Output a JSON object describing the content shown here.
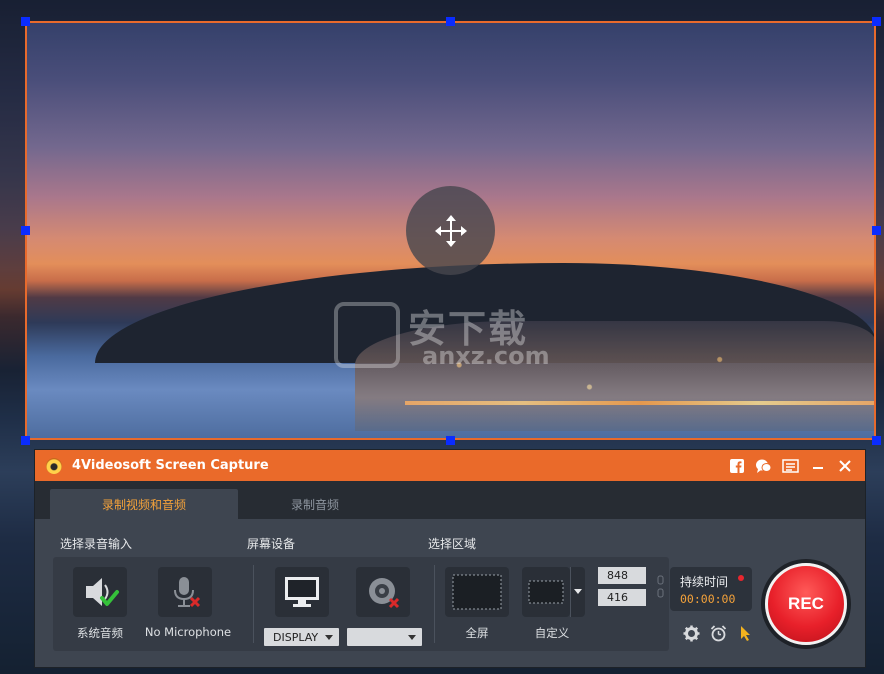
{
  "window": {
    "title": "4Videosoft Screen Capture"
  },
  "watermark": {
    "cn": "安下载",
    "en": "anxz.com"
  },
  "tabs": [
    {
      "label": "录制视频和音频",
      "active": true
    },
    {
      "label": "录制音频",
      "active": false
    }
  ],
  "sections": {
    "audio_input": "选择录音输入",
    "screen_device": "屏幕设备",
    "select_area": "选择区域"
  },
  "audio": {
    "system_sound_label": "系统音频",
    "microphone_label": "No Microphone"
  },
  "screen": {
    "display_select": "DISPLAY",
    "camera_select": ""
  },
  "area": {
    "fullscreen_label": "全屏",
    "custom_label": "自定义",
    "width": "848",
    "height": "416"
  },
  "timer": {
    "label": "持续时间",
    "value": "00:00:00"
  },
  "rec_label": "REC",
  "colors": {
    "accent": "#ea6a2a",
    "active_tab_text": "#f4a23a",
    "rec_red": "#e8202a",
    "selection_border": "#e86a2c",
    "handle_blue": "#0a2cff"
  }
}
